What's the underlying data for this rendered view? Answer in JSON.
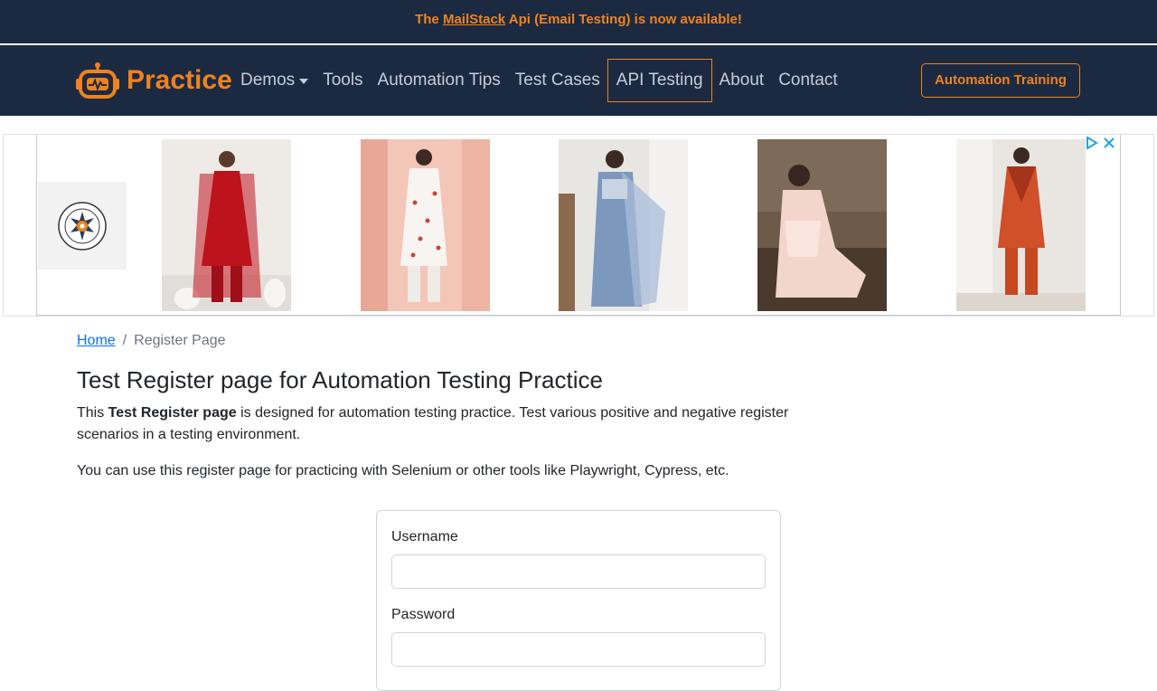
{
  "announcement": {
    "prefix": "The ",
    "link": "MailStack",
    "suffix": " Api (Email Testing) is now available!"
  },
  "navbar": {
    "brand": "Practice",
    "items": [
      {
        "label": "Demos"
      },
      {
        "label": "Tools"
      },
      {
        "label": "Automation Tips"
      },
      {
        "label": "Test Cases"
      },
      {
        "label": "API Testing"
      },
      {
        "label": "About"
      },
      {
        "label": "Contact"
      }
    ],
    "cta": "Automation Training"
  },
  "colors": {
    "navy": "#1b2a41",
    "accent": "#f0821e",
    "link": "#0d6efd"
  },
  "breadcrumb": {
    "home": "Home",
    "separator": "/",
    "current": "Register Page"
  },
  "page": {
    "title": "Test Register page for Automation Testing Practice",
    "intro_before": "This ",
    "intro_bold": "Test Register page",
    "intro_after": " is designed for automation testing practice. Test various positive and negative register scenarios in a testing environment.",
    "note": "You can use this register page for practicing with Selenium or other tools like Playwright, Cypress, etc."
  },
  "form": {
    "username_label": "Username",
    "password_label": "Password",
    "username_value": "",
    "password_value": ""
  },
  "ad": {
    "logo_icon": "brand-seal-icon",
    "photos": [
      "red-kurta-set-photo",
      "white-embroidered-suit-photo",
      "blue-saree-photo",
      "pink-lace-suit-photo",
      "orange-printed-coord-photo"
    ]
  }
}
